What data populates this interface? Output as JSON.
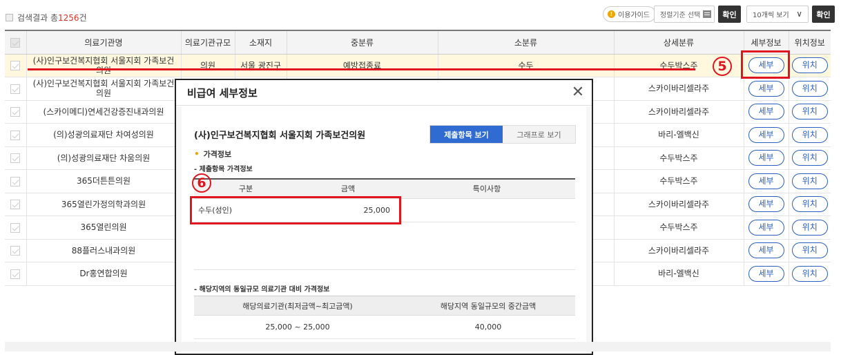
{
  "toolbar": {
    "result_prefix": "검색결과 총",
    "result_count": "1256",
    "result_suffix": "건",
    "guide_label": "이용가이드",
    "sort_label": "정렬기준 선택",
    "confirm_label": "확인",
    "page_size_label": "10개씩 보기",
    "confirm2_label": "확인"
  },
  "table": {
    "headers": [
      "의료기관명",
      "의료기관규모",
      "소재지",
      "중분류",
      "소분류",
      "상세분류",
      "세부정보",
      "위치정보"
    ],
    "detail_label": "세부",
    "location_label": "위치",
    "rows": [
      {
        "name": "(사)인구보건복지협회 서울지회 가족보건의원",
        "scale": "의원",
        "addr": "서울 광진구",
        "mid": "예방접종료",
        "small": "수두",
        "detail": "수두박스주"
      },
      {
        "name": "(사)인구보건복지협회 서울지회 가족보건의원",
        "scale": "",
        "addr": "",
        "mid": "",
        "small": "",
        "detail": "스카이바리셀라주"
      },
      {
        "name": "(스카이메디)연세건강증진내과의원",
        "scale": "",
        "addr": "",
        "mid": "",
        "small": "",
        "detail": "스카이바리셀라주"
      },
      {
        "name": "(의)성광의료재단 차여성의원",
        "scale": "",
        "addr": "",
        "mid": "",
        "small": "",
        "detail": "바리-엘백신"
      },
      {
        "name": "(의)성광의료재단 차움의원",
        "scale": "",
        "addr": "",
        "mid": "",
        "small": "",
        "detail": "수두박스주"
      },
      {
        "name": "365더튼튼의원",
        "scale": "",
        "addr": "",
        "mid": "",
        "small": "",
        "detail": "수두박스주"
      },
      {
        "name": "365열린가정의학과의원",
        "scale": "",
        "addr": "",
        "mid": "",
        "small": "",
        "detail": "스카이바리셀라주"
      },
      {
        "name": "365열린의원",
        "scale": "",
        "addr": "",
        "mid": "",
        "small": "",
        "detail": "수두박스주"
      },
      {
        "name": "88플러스내과의원",
        "scale": "",
        "addr": "",
        "mid": "",
        "small": "",
        "detail": "스카이바리셀라주"
      },
      {
        "name": "Dr홍연합의원",
        "scale": "",
        "addr": "",
        "mid": "",
        "small": "",
        "detail": "바리-엘백신"
      }
    ]
  },
  "annotations": {
    "step5": "5",
    "step6": "6",
    "color": "#e0141e"
  },
  "modal": {
    "title": "비급여 세부정보",
    "org_name": "(사)인구보건복지협회 서울지회 가족보건의원",
    "tab_active": "제출항목 보기",
    "tab_inactive": "그래프로 보기",
    "section": "가격정보",
    "price_sub": "- 제출항목 가격정보",
    "price_headers": [
      "구분",
      "금액",
      "특이사항"
    ],
    "price_row": {
      "item": "수두(성인)",
      "amount": "25,000",
      "note": ""
    },
    "compare_sub": "- 해당지역의 동일규모 의료기관 대비 가격정보",
    "compare_headers": [
      "해당의료기관(최저금액~최고금액)",
      "해당지역 동일규모의 중간금액"
    ],
    "compare_row": {
      "range": "25,000 ~ 25,000",
      "median": "40,000"
    }
  },
  "colors": {
    "accent": "#2f6bd0",
    "link": "#2a5fbf",
    "highlight_row": "#fff8df"
  }
}
